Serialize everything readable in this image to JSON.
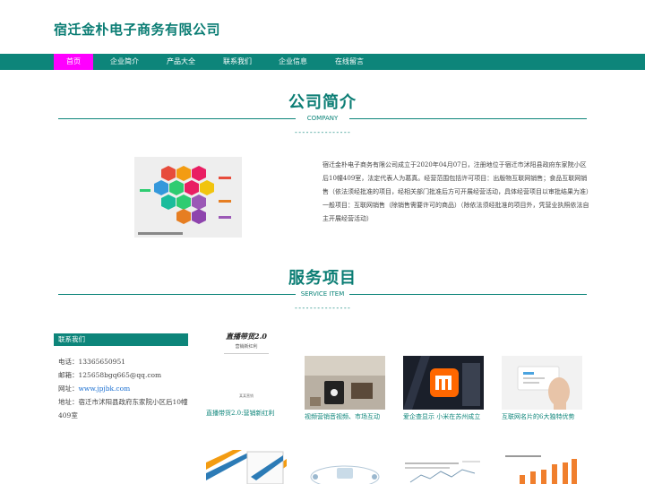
{
  "header": {
    "site_title": "宿迁金朴电子商务有限公司"
  },
  "nav": {
    "items": [
      {
        "label": "首页",
        "active": true
      },
      {
        "label": "企业简介",
        "active": false
      },
      {
        "label": "产品大全",
        "active": false
      },
      {
        "label": "联系我们",
        "active": false
      },
      {
        "label": "企业信息",
        "active": false
      },
      {
        "label": "在线留言",
        "active": false
      }
    ]
  },
  "about": {
    "title": "公司简介",
    "subtitle": "COMPANY",
    "dashes": "----------------",
    "text": "宿迁金朴电子商务有限公司成立于2020年04月07日，注册地位于宿迁市沭阳县政府东家院小区后10幢409室，法定代表人为葛真。经营范围包括许可项目：出版物互联网销售；食品互联网销售（依法须经批准的项目，经相关部门批准后方可开展经营活动，具体经营项目以审批结果为准）一般项目：互联网销售（除销售需要许可的商品）（除依法须经批准的项目外，凭营业执照依法自主开展经营活动）"
  },
  "services": {
    "title": "服务项目",
    "subtitle": "SERVICE ITEM",
    "dashes": "----------------"
  },
  "contact": {
    "heading": "联系我们",
    "phone": "电话：13365650951",
    "email": "邮箱：125658bgq665@qq.com",
    "website_label": "网址：",
    "website": "www.jpjbk.com",
    "address": "地址：宿迁市沭阳县政府东家院小区后10幢409室"
  },
  "products": [
    {
      "caption": "直播带货2.0:营销新红利",
      "thumb_title": "直播带货2.0",
      "thumb_sub": "营销新红利",
      "thumb_foot": "某某营销"
    },
    {
      "caption": "视频营销音视频、市场互动"
    },
    {
      "caption": "爱企查显示 小米在苏州成立"
    },
    {
      "caption": "互联网名片的6大独特优势"
    }
  ],
  "colors": {
    "primary": "#0d857a",
    "active_nav": "#ff00ff",
    "title": "#0b7d74"
  }
}
